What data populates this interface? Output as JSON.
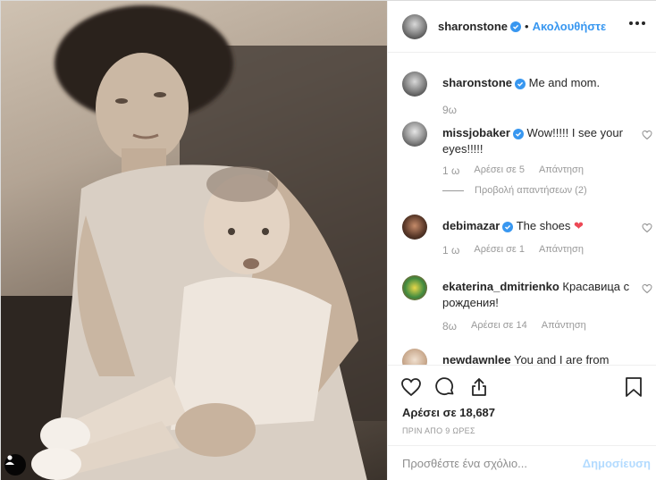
{
  "post": {
    "author": "sharonstone",
    "follow_label": "Ακολουθήστε",
    "separator": "•",
    "caption": {
      "author": "sharonstone",
      "text": "Me and mom.",
      "time": "9ω"
    },
    "comments": [
      {
        "author": "missjobaker",
        "verified": true,
        "text": "Wow!!!!! I see your eyes!!!!!",
        "time": "1 ω",
        "likes": "Αρέσει σε 5",
        "reply": "Απάντηση",
        "view_replies": "Προβολή απαντήσεων (2)"
      },
      {
        "author": "debimazar",
        "verified": true,
        "text": "The shoes",
        "emoji": "❤",
        "time": "1 ω",
        "likes": "Αρέσει σε 1",
        "reply": "Απάντηση"
      },
      {
        "author": "ekaterina_dmitrienko",
        "verified": false,
        "text": "Красавица с рождения!",
        "time": "8ω",
        "likes": "Αρέσει σε 14",
        "reply": "Απάντηση"
      },
      {
        "author": "newdawnlee",
        "verified": false,
        "text": "You and I are from"
      }
    ],
    "likes_label": "Αρέσει σε 18,687",
    "posted_ago": "ΠΡΙΝ ΑΠΟ 9 ΩΡΕΣ",
    "comment_placeholder": "Προσθέστε ένα σχόλιο...",
    "publish_label": "Δημοσίευση"
  },
  "colors": {
    "link_blue": "#3897f0",
    "publish_disabled": "#b3dbff",
    "heart_red": "#ed4956"
  },
  "icons": [
    "heart-icon",
    "comment-icon",
    "share-icon",
    "bookmark-icon",
    "verified-badge-icon",
    "more-options-icon",
    "person-tag-icon"
  ]
}
